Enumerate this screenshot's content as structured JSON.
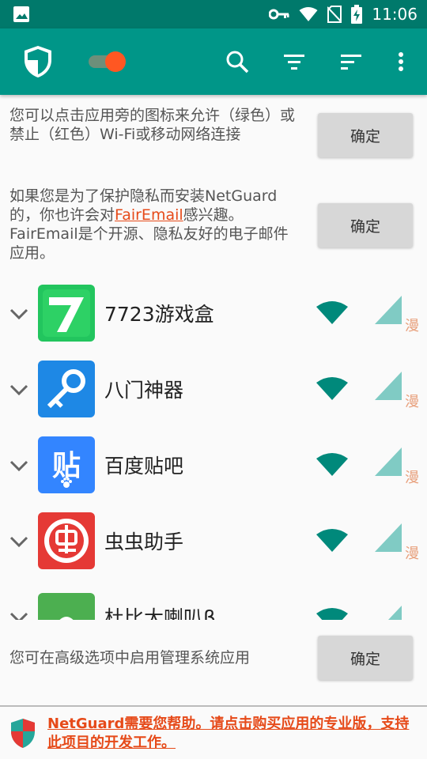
{
  "status_bar": {
    "time": "11:06",
    "icons": [
      "image-icon",
      "vpn-key-icon",
      "wifi-icon",
      "no-sim-icon",
      "battery-charging-icon"
    ]
  },
  "toolbar": {
    "icons": [
      "netguard-shield-icon",
      "toggle-switch",
      "search-icon",
      "filter-icon",
      "sort-icon",
      "overflow-menu-icon"
    ],
    "colors": {
      "primary": "#009688",
      "primary_dark": "#00796b",
      "switch_thumb": "#ff5722"
    }
  },
  "notices": [
    {
      "text": "您可以点击应用旁的图标来允许（绿色）或禁止（红色）Wi-Fi或移动网络连接",
      "button": "确定"
    },
    {
      "text_before": "如果您是为了保护隐私而安装NetGuard的，你也许会对",
      "link": "FairEmail",
      "text_after": "感兴趣。FairEmail是个开源、隐私友好的电子邮件应用。",
      "button": "确定"
    }
  ],
  "apps": [
    {
      "name": "7723游戏盒",
      "tag": "漫"
    },
    {
      "name": "八门神器",
      "tag": "漫"
    },
    {
      "name": "百度贴吧",
      "tag": "漫"
    },
    {
      "name": "虫虫助手",
      "tag": "漫"
    },
    {
      "name": "杜比大喇叭β",
      "tag": ""
    }
  ],
  "system_notice": {
    "text": "您可在高级选项中启用管理系统应用",
    "button": "确定"
  },
  "footer": {
    "text": "NetGuard需要您帮助。请点击购买应用的专业版，支持此项目的开发工作。"
  }
}
